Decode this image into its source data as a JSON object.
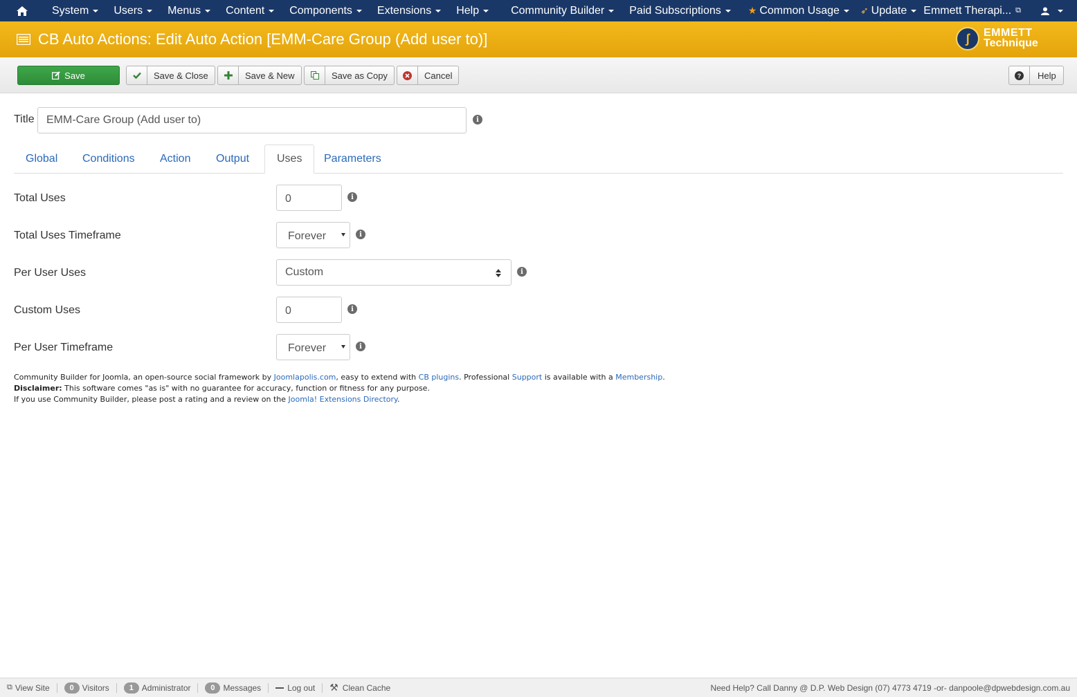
{
  "topnav": {
    "items": [
      {
        "label": "System"
      },
      {
        "label": "Users"
      },
      {
        "label": "Menus"
      },
      {
        "label": "Content"
      },
      {
        "label": "Components"
      },
      {
        "label": "Extensions"
      },
      {
        "label": "Help"
      }
    ],
    "community_builder": "Community Builder",
    "paid_subscriptions": "Paid Subscriptions",
    "common_usage": "Common Usage",
    "update": "Update",
    "site_name": "Emmett Therapi...",
    "colors": {
      "bar": "#1a3867",
      "star": "#f39c12"
    }
  },
  "header": {
    "title": "CB Auto Actions: Edit Auto Action [EMM-Care Group (Add user to)]",
    "logo_line1": "EMMETT",
    "logo_line2": "Technique",
    "color": "#f0b312"
  },
  "toolbar": {
    "save": "Save",
    "save_close": "Save & Close",
    "save_new": "Save & New",
    "save_copy": "Save as Copy",
    "cancel": "Cancel",
    "help": "Help"
  },
  "form": {
    "title_label": "Title",
    "title_value": "EMM-Care Group (Add user to)",
    "tabs": [
      "Global",
      "Conditions",
      "Action",
      "Output",
      "Uses",
      "Parameters"
    ],
    "active_tab": "Uses",
    "fields": {
      "total_uses_label": "Total Uses",
      "total_uses_value": "0",
      "total_timeframe_label": "Total Uses Timeframe",
      "total_timeframe_value": "Forever",
      "per_user_label": "Per User Uses",
      "per_user_value": "Custom",
      "custom_uses_label": "Custom Uses",
      "custom_uses_value": "0",
      "per_user_timeframe_label": "Per User Timeframe",
      "per_user_timeframe_value": "Forever"
    }
  },
  "footer": {
    "line1_a": "Community Builder for Joomla, an open-source social framework by ",
    "link_joomlapolis": "Joomlapolis.com",
    "line1_b": ", easy to extend with ",
    "link_cb_plugins": "CB plugins",
    "line1_c": ". Professional ",
    "link_support": "Support",
    "line1_d": " is available with a ",
    "link_membership": "Membership",
    "line1_e": ".",
    "disclaimer_label": "Disclaimer:",
    "disclaimer_text": " This software comes \"as is\" with no guarantee for accuracy, function or fitness for any purpose.",
    "line3_a": "If you use Community Builder, please post a rating and a review on the ",
    "link_jed": "Joomla! Extensions Directory",
    "line3_b": "."
  },
  "statusbar": {
    "view_site": "View Site",
    "visitors_count": "0",
    "visitors": "Visitors",
    "admin_count": "1",
    "administrator": "Administrator",
    "messages_count": "0",
    "messages": "Messages",
    "logout": "Log out",
    "clean_cache": "Clean Cache",
    "help_text": "Need Help? Call Danny @ D.P. Web Design (07) 4773 4719 -or- danpoole@dpwebdesign.com.au"
  }
}
